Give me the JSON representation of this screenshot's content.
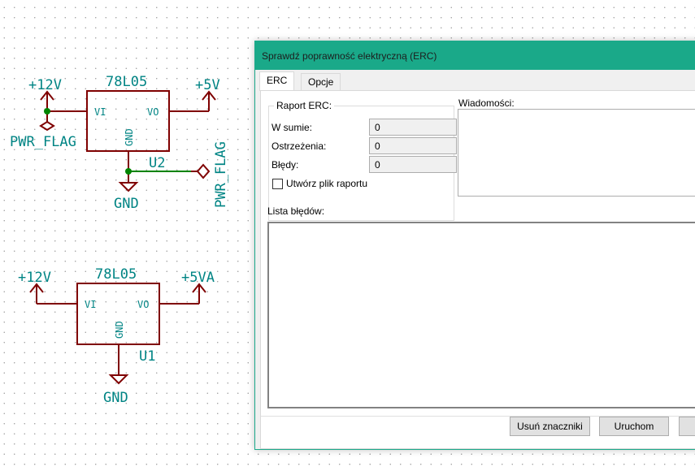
{
  "schematic": {
    "u2": {
      "value": "78L05",
      "ref": "U2",
      "pin_in": "VI",
      "pin_out": "VO",
      "pin_gnd": "GND",
      "in_power": "+12V",
      "out_power": "+5V",
      "gnd_label": "GND",
      "flag1": "PWR_FLAG",
      "flag2": "PWR_FLAG"
    },
    "u1": {
      "value": "78L05",
      "ref": "U1",
      "pin_in": "VI",
      "pin_out": "VO",
      "pin_gnd": "GND",
      "in_power": "+12V",
      "out_power": "+5VA",
      "gnd_label": "GND"
    },
    "colors": {
      "wire": "#7f0000",
      "net": "#008400",
      "text": "#008484",
      "junction": "#008400"
    }
  },
  "dialog": {
    "title": "Sprawdź poprawność elektryczną (ERC)",
    "tabs": [
      {
        "label": "ERC",
        "active": true
      },
      {
        "label": "Opcje",
        "active": false
      }
    ],
    "report_group": "Raport ERC:",
    "total_label": "W sumie:",
    "total_value": "0",
    "warnings_label": "Ostrzeżenia:",
    "warnings_value": "0",
    "errors_label": "Błędy:",
    "errors_value": "0",
    "create_report_label": "Utwórz plik raportu",
    "create_report_checked": false,
    "messages_label": "Wiadomości:",
    "error_list_label": "Lista błędów:",
    "buttons": {
      "delete_markers": "Usuń znaczniki",
      "run": "Uruchom"
    },
    "title_color": "#1aa989"
  }
}
